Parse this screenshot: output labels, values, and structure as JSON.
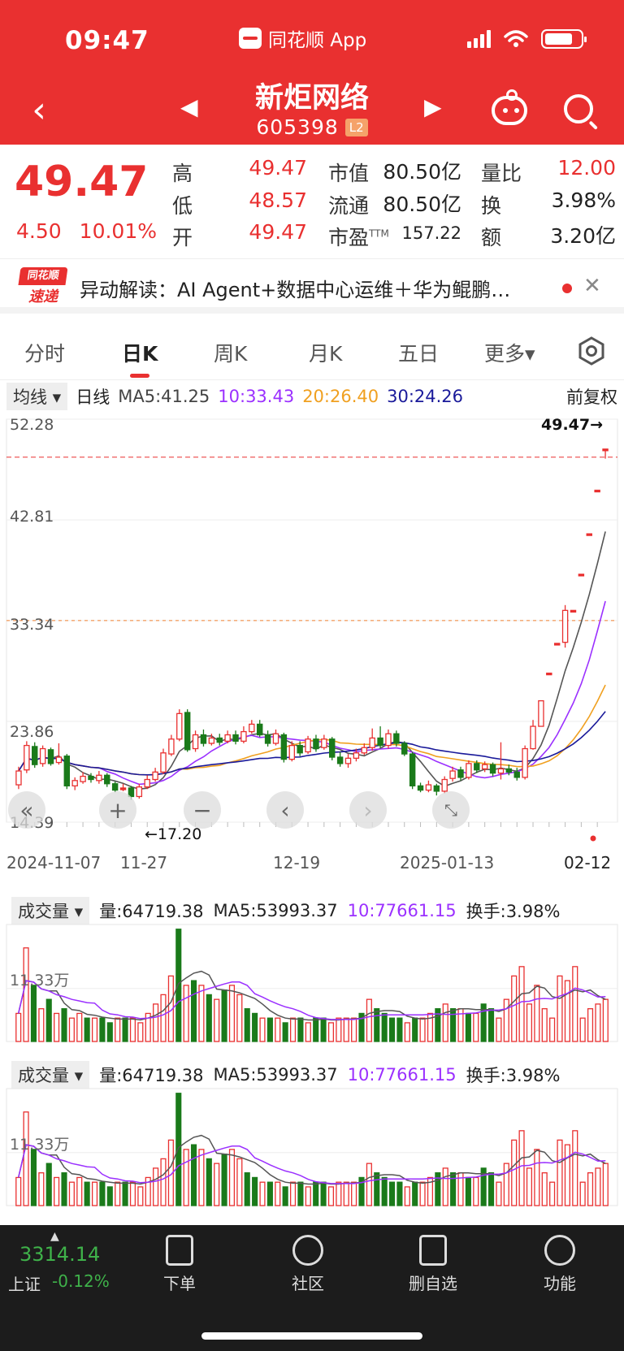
{
  "status_bar": {
    "time": "09:47",
    "app": "同花顺 App"
  },
  "header": {
    "stock_name": "新炬网络",
    "stock_code": "605398",
    "level_badge": "L2",
    "icons": [
      "back-icon",
      "prev-stock-icon",
      "next-stock-icon",
      "robot-icon",
      "search-icon"
    ]
  },
  "quote": {
    "price": "49.47",
    "change": "4.50",
    "change_pct": "10.01%",
    "high_label": "高",
    "high": "49.47",
    "low_label": "低",
    "low": "48.57",
    "open_label": "开",
    "open": "49.47",
    "mktcap_label": "市值",
    "mktcap": "80.50亿",
    "float_label": "流通",
    "float": "80.50亿",
    "pe_label": "市盈",
    "pe_sup": "TTM",
    "pe": "157.22",
    "vol_ratio_label": "量比",
    "vol_ratio": "12.00",
    "turnover_label": "换",
    "turnover": "3.98%",
    "amount_label": "额",
    "amount": "3.20亿"
  },
  "news": {
    "logo_top": "同花顺",
    "logo_bottom": "速递",
    "text": "异动解读：AI Agent+数据中心运维＋华为鲲鹏…"
  },
  "tabs": [
    "分时",
    "日K",
    "周K",
    "月K",
    "五日",
    "更多▾"
  ],
  "active_tab": 1,
  "indicator": {
    "select": "均线 ▾",
    "period": "日线",
    "ma5": "MA5:41.25",
    "ma10": "10:33.43",
    "ma20": "20:26.40",
    "ma30": "30:24.26",
    "adjust": "前复权"
  },
  "colors": {
    "up": "#e93030",
    "down": "#1a7a1a",
    "ma5": "#555555",
    "ma10": "#9b30ff",
    "ma20": "#f0a020",
    "ma30": "#1a1a9a",
    "header": "#e93030"
  },
  "chart_data": {
    "type": "candlestick",
    "price_axis": [
      "52.28",
      "42.81",
      "33.34",
      "23.86",
      "14.39"
    ],
    "ylim": [
      14.39,
      52.28
    ],
    "max_marker": "49.47→",
    "min_marker": "←17.20",
    "dates": [
      "2024-11-07",
      "11-27",
      "12-19",
      "2025-01-13",
      "02-12"
    ],
    "candles": [
      {
        "o": 17.9,
        "c": 19.2,
        "h": 19.6,
        "l": 17.5
      },
      {
        "o": 19.3,
        "c": 21.6,
        "h": 22.0,
        "l": 19.0
      },
      {
        "o": 21.5,
        "c": 19.8,
        "h": 21.9,
        "l": 19.5
      },
      {
        "o": 19.9,
        "c": 21.3,
        "h": 21.6,
        "l": 19.6
      },
      {
        "o": 21.2,
        "c": 19.9,
        "h": 21.4,
        "l": 19.7
      },
      {
        "o": 20.0,
        "c": 20.5,
        "h": 21.8,
        "l": 19.8
      },
      {
        "o": 20.6,
        "c": 17.8,
        "h": 20.8,
        "l": 17.5
      },
      {
        "o": 17.8,
        "c": 18.3,
        "h": 18.6,
        "l": 17.4
      },
      {
        "o": 18.2,
        "c": 18.7,
        "h": 19.1,
        "l": 18.0
      },
      {
        "o": 18.7,
        "c": 18.4,
        "h": 19.0,
        "l": 18.1
      },
      {
        "o": 18.3,
        "c": 18.8,
        "h": 19.2,
        "l": 18.0
      },
      {
        "o": 18.8,
        "c": 18.0,
        "h": 19.0,
        "l": 17.7
      },
      {
        "o": 18.0,
        "c": 17.4,
        "h": 18.2,
        "l": 17.2
      },
      {
        "o": 17.5,
        "c": 17.6,
        "h": 18.0,
        "l": 17.3
      },
      {
        "o": 17.6,
        "c": 16.8,
        "h": 17.8,
        "l": 16.5
      },
      {
        "o": 16.8,
        "c": 17.7,
        "h": 18.0,
        "l": 16.6
      },
      {
        "o": 17.7,
        "c": 18.4,
        "h": 18.8,
        "l": 17.5
      },
      {
        "o": 18.4,
        "c": 19.1,
        "h": 19.5,
        "l": 18.2
      },
      {
        "o": 19.1,
        "c": 20.9,
        "h": 21.3,
        "l": 18.9
      },
      {
        "o": 20.8,
        "c": 22.2,
        "h": 22.6,
        "l": 20.6
      },
      {
        "o": 22.2,
        "c": 24.6,
        "h": 25.0,
        "l": 22.0
      },
      {
        "o": 24.7,
        "c": 21.2,
        "h": 25.0,
        "l": 21.0
      },
      {
        "o": 21.3,
        "c": 22.6,
        "h": 23.0,
        "l": 21.0
      },
      {
        "o": 22.6,
        "c": 21.8,
        "h": 23.1,
        "l": 21.5
      },
      {
        "o": 21.8,
        "c": 22.3,
        "h": 22.7,
        "l": 21.6
      },
      {
        "o": 22.3,
        "c": 21.9,
        "h": 22.7,
        "l": 21.6
      },
      {
        "o": 22.0,
        "c": 22.6,
        "h": 23.0,
        "l": 21.8
      },
      {
        "o": 22.6,
        "c": 22.0,
        "h": 23.0,
        "l": 21.7
      },
      {
        "o": 22.0,
        "c": 22.9,
        "h": 23.4,
        "l": 21.8
      },
      {
        "o": 22.9,
        "c": 23.6,
        "h": 24.0,
        "l": 22.7
      },
      {
        "o": 23.6,
        "c": 22.6,
        "h": 24.0,
        "l": 22.4
      },
      {
        "o": 22.6,
        "c": 21.8,
        "h": 23.0,
        "l": 21.5
      },
      {
        "o": 21.8,
        "c": 22.7,
        "h": 23.1,
        "l": 21.6
      },
      {
        "o": 22.6,
        "c": 20.3,
        "h": 22.8,
        "l": 20.0
      },
      {
        "o": 20.3,
        "c": 21.6,
        "h": 22.0,
        "l": 20.1
      },
      {
        "o": 21.6,
        "c": 20.9,
        "h": 22.0,
        "l": 20.6
      },
      {
        "o": 21.0,
        "c": 22.2,
        "h": 22.5,
        "l": 20.8
      },
      {
        "o": 22.2,
        "c": 21.3,
        "h": 22.6,
        "l": 21.0
      },
      {
        "o": 21.4,
        "c": 22.2,
        "h": 22.6,
        "l": 21.2
      },
      {
        "o": 22.2,
        "c": 20.5,
        "h": 22.4,
        "l": 20.2
      },
      {
        "o": 20.5,
        "c": 19.9,
        "h": 21.0,
        "l": 19.6
      },
      {
        "o": 19.9,
        "c": 20.4,
        "h": 20.8,
        "l": 19.5
      },
      {
        "o": 20.4,
        "c": 20.9,
        "h": 21.3,
        "l": 20.1
      },
      {
        "o": 20.9,
        "c": 21.4,
        "h": 21.8,
        "l": 20.7
      },
      {
        "o": 21.4,
        "c": 22.3,
        "h": 23.2,
        "l": 21.1
      },
      {
        "o": 22.3,
        "c": 21.6,
        "h": 23.4,
        "l": 21.3
      },
      {
        "o": 21.6,
        "c": 22.7,
        "h": 23.1,
        "l": 21.3
      },
      {
        "o": 22.7,
        "c": 21.8,
        "h": 23.0,
        "l": 21.5
      },
      {
        "o": 21.8,
        "c": 20.8,
        "h": 22.0,
        "l": 20.6
      },
      {
        "o": 20.8,
        "c": 17.8,
        "h": 21.0,
        "l": 17.5
      },
      {
        "o": 17.8,
        "c": 17.4,
        "h": 18.1,
        "l": 17.2
      },
      {
        "o": 17.4,
        "c": 17.9,
        "h": 18.3,
        "l": 17.2
      },
      {
        "o": 17.8,
        "c": 17.3,
        "h": 18.0,
        "l": 16.9
      },
      {
        "o": 17.3,
        "c": 18.4,
        "h": 18.7,
        "l": 17.1
      },
      {
        "o": 18.5,
        "c": 19.2,
        "h": 19.6,
        "l": 18.2
      },
      {
        "o": 19.3,
        "c": 18.6,
        "h": 19.6,
        "l": 18.3
      },
      {
        "o": 18.6,
        "c": 19.9,
        "h": 20.2,
        "l": 18.4
      },
      {
        "o": 19.9,
        "c": 19.3,
        "h": 20.2,
        "l": 19.0
      },
      {
        "o": 19.4,
        "c": 19.8,
        "h": 20.1,
        "l": 19.1
      },
      {
        "o": 19.8,
        "c": 19.0,
        "h": 20.0,
        "l": 18.7
      },
      {
        "o": 19.0,
        "c": 19.4,
        "h": 21.9,
        "l": 18.4
      },
      {
        "o": 19.4,
        "c": 19.1,
        "h": 19.8,
        "l": 18.8
      },
      {
        "o": 19.1,
        "c": 18.6,
        "h": 19.5,
        "l": 18.3
      },
      {
        "o": 18.6,
        "c": 21.3,
        "h": 21.6,
        "l": 18.4
      },
      {
        "o": 21.3,
        "c": 23.4,
        "h": 24.0,
        "l": 21.2
      },
      {
        "o": 23.4,
        "c": 25.8,
        "h": 25.8,
        "l": 23.4
      },
      {
        "o": 28.4,
        "c": 28.4,
        "h": 28.4,
        "l": 28.4
      },
      {
        "o": 31.2,
        "c": 31.2,
        "h": 31.2,
        "l": 31.2
      },
      {
        "o": 31.3,
        "c": 34.3,
        "h": 34.8,
        "l": 30.8
      },
      {
        "o": 34.3,
        "c": 34.3,
        "h": 34.3,
        "l": 34.3
      },
      {
        "o": 37.7,
        "c": 37.7,
        "h": 37.7,
        "l": 37.7
      },
      {
        "o": 41.5,
        "c": 41.5,
        "h": 41.5,
        "l": 41.5
      },
      {
        "o": 45.6,
        "c": 45.6,
        "h": 45.6,
        "l": 45.6
      },
      {
        "o": 49.47,
        "c": 49.47,
        "h": 49.47,
        "l": 48.57
      }
    ]
  },
  "volume_panels": [
    {
      "select": "成交量 ▾",
      "vol": "量:64719.38",
      "ma5": "MA5:53993.37",
      "ma10": "10:77661.15",
      "turnover": "换手:3.98%",
      "axis": "11.33万"
    },
    {
      "select": "成交量 ▾",
      "vol": "量:64719.38",
      "ma5": "MA5:53993.37",
      "ma10": "10:77661.15",
      "turnover": "换手:3.98%",
      "axis": "11.33万"
    }
  ],
  "volumes": [
    6,
    20,
    12,
    7,
    9,
    6,
    7,
    5,
    6,
    5,
    5,
    5,
    4,
    5,
    5,
    5,
    4,
    6,
    8,
    10,
    14,
    24,
    12,
    13,
    12,
    10,
    9,
    11,
    12,
    10,
    7,
    6,
    5,
    5,
    5,
    4,
    5,
    5,
    4,
    5,
    5,
    4,
    5,
    5,
    5,
    6,
    9,
    7,
    6,
    5,
    5,
    4,
    5,
    5,
    6,
    7,
    8,
    7,
    7,
    6,
    6,
    8,
    7,
    5,
    9,
    14,
    16,
    8,
    12,
    7,
    5,
    14,
    13,
    16,
    5,
    7,
    8,
    9
  ],
  "bottom_bar": {
    "index_value": "3314.14",
    "index_name": "上证",
    "index_change": "-0.12%",
    "nav": [
      "下单",
      "社区",
      "删自选",
      "功能"
    ]
  }
}
